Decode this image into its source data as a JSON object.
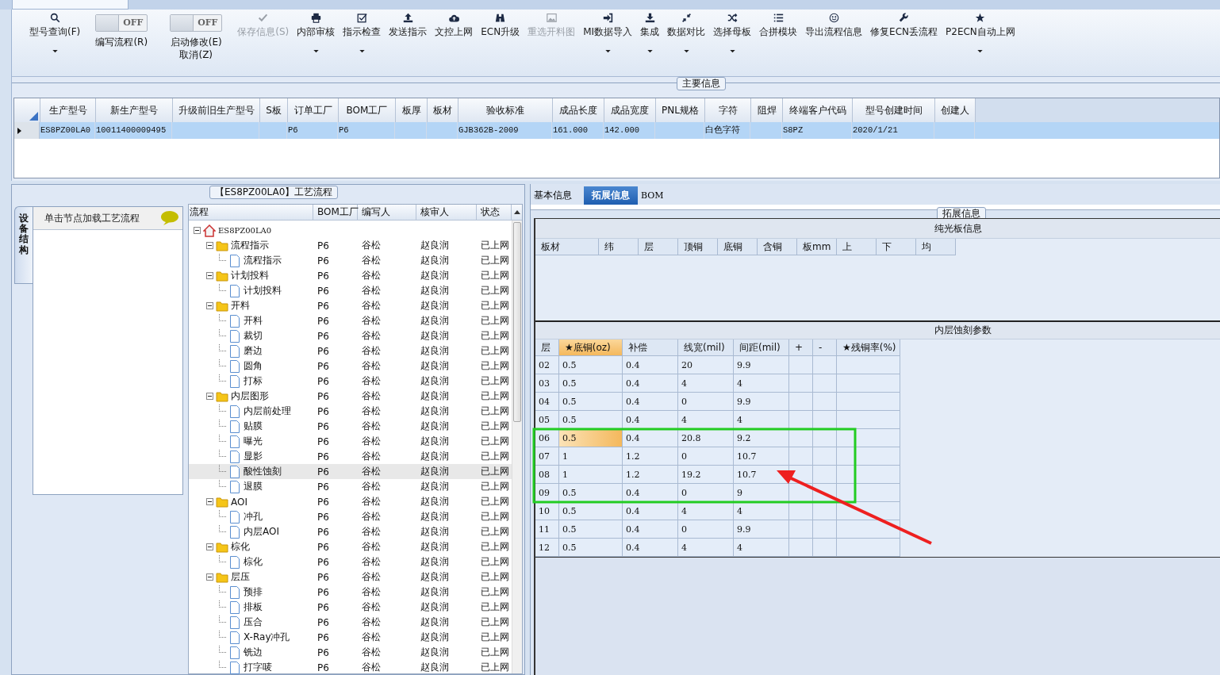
{
  "toolbar": {
    "items": [
      {
        "kind": "button",
        "label": "型号查询(F)",
        "dropdown": true,
        "disabled": false
      },
      {
        "kind": "toggle",
        "label": "编写流程(R)",
        "on": false,
        "state_text": "OFF"
      },
      {
        "kind": "toggle",
        "label": "启动修改(E) 取消(Z)",
        "on": false,
        "state_text": "OFF"
      },
      {
        "kind": "button",
        "label": "保存信息(S)",
        "dropdown": false,
        "disabled": true
      },
      {
        "kind": "button",
        "label": "内部审核",
        "dropdown": true,
        "disabled": false
      },
      {
        "kind": "button",
        "label": "指示检查",
        "dropdown": true,
        "disabled": false
      },
      {
        "kind": "button",
        "label": "发送指示",
        "dropdown": false,
        "disabled": false
      },
      {
        "kind": "button",
        "label": "文控上网",
        "dropdown": false,
        "disabled": false
      },
      {
        "kind": "button",
        "label": "ECN升级",
        "dropdown": false,
        "disabled": false
      },
      {
        "kind": "button",
        "label": "重选开料图",
        "dropdown": false,
        "disabled": true
      },
      {
        "kind": "button",
        "label": "MI数据导入",
        "dropdown": true,
        "disabled": false
      },
      {
        "kind": "button",
        "label": "集成",
        "dropdown": true,
        "disabled": false
      },
      {
        "kind": "button",
        "label": "数据对比",
        "dropdown": true,
        "disabled": false
      },
      {
        "kind": "button",
        "label": "选择母板",
        "dropdown": true,
        "disabled": false
      },
      {
        "kind": "button",
        "label": "合拼模块",
        "dropdown": false,
        "disabled": false
      },
      {
        "kind": "button",
        "label": "导出流程信息",
        "dropdown": false,
        "disabled": false
      },
      {
        "kind": "button",
        "label": "修复ECN丢流程",
        "dropdown": false,
        "disabled": false
      },
      {
        "kind": "button",
        "label": "P2ECN自动上网",
        "dropdown": true,
        "disabled": false
      }
    ]
  },
  "main_info": {
    "title": "主要信息",
    "columns": [
      "生产型号",
      "新生产型号",
      "升级前旧生产型号",
      "S板",
      "订单工厂",
      "BOM工厂",
      "板厚",
      "板材",
      "验收标准",
      "成品长度",
      "成品宽度",
      "PNL规格",
      "字符",
      "阻焊",
      "终端客户代码",
      "型号创建时间",
      "创建人"
    ],
    "rows": [
      {
        "selected": true,
        "cells": [
          "ES8PZ00LA0",
          "10011400009495",
          null,
          null,
          "P6",
          "P6",
          null,
          null,
          "GJB362B-2009",
          "161.000",
          "142.000",
          null,
          "白色字符",
          null,
          "S8PZ",
          "2020/1/21",
          null
        ]
      }
    ]
  },
  "process": {
    "title": "【ES8PZ00LA0】工艺流程",
    "side_tab": "设备结构",
    "hint": "单击节点加载工艺流程",
    "columns": [
      "流程",
      "BOM工厂",
      "编写人",
      "核审人",
      "状态"
    ],
    "tree": {
      "label": "ES8PZ00LA0",
      "expanded": true,
      "selected": false,
      "children": [
        {
          "label": "流程指示",
          "bom": "P6",
          "writer": "谷松",
          "reviewer": "赵良润",
          "status": "已上网",
          "expanded": true,
          "selected": false,
          "children": [
            {
              "label": "流程指示",
              "bom": "P6",
              "writer": "谷松",
              "reviewer": "赵良润",
              "status": "已上网",
              "selected": false
            }
          ]
        },
        {
          "label": "计划投料",
          "bom": "P6",
          "writer": "谷松",
          "reviewer": "赵良润",
          "status": "已上网",
          "expanded": true,
          "selected": false,
          "children": [
            {
              "label": "计划投料",
              "bom": "P6",
              "writer": "谷松",
              "reviewer": "赵良润",
              "status": "已上网",
              "selected": false
            }
          ]
        },
        {
          "label": "开料",
          "bom": "P6",
          "writer": "谷松",
          "reviewer": "赵良润",
          "status": "已上网",
          "expanded": true,
          "selected": false,
          "children": [
            {
              "label": "开料",
              "bom": "P6",
              "writer": "谷松",
              "reviewer": "赵良润",
              "status": "已上网",
              "selected": false
            },
            {
              "label": "裁切",
              "bom": "P6",
              "writer": "谷松",
              "reviewer": "赵良润",
              "status": "已上网",
              "selected": false
            },
            {
              "label": "磨边",
              "bom": "P6",
              "writer": "谷松",
              "reviewer": "赵良润",
              "status": "已上网",
              "selected": false
            },
            {
              "label": "圆角",
              "bom": "P6",
              "writer": "谷松",
              "reviewer": "赵良润",
              "status": "已上网",
              "selected": false
            },
            {
              "label": "打标",
              "bom": "P6",
              "writer": "谷松",
              "reviewer": "赵良润",
              "status": "已上网",
              "selected": false
            }
          ]
        },
        {
          "label": "内层图形",
          "bom": "P6",
          "writer": "谷松",
          "reviewer": "赵良润",
          "status": "已上网",
          "expanded": true,
          "selected": false,
          "children": [
            {
              "label": "内层前处理",
              "bom": "P6",
              "writer": "谷松",
              "reviewer": "赵良润",
              "status": "已上网",
              "selected": false
            },
            {
              "label": "贴膜",
              "bom": "P6",
              "writer": "谷松",
              "reviewer": "赵良润",
              "status": "已上网",
              "selected": false
            },
            {
              "label": "曝光",
              "bom": "P6",
              "writer": "谷松",
              "reviewer": "赵良润",
              "status": "已上网",
              "selected": false
            },
            {
              "label": "显影",
              "bom": "P6",
              "writer": "谷松",
              "reviewer": "赵良润",
              "status": "已上网",
              "selected": false
            },
            {
              "label": "酸性蚀刻",
              "bom": "P6",
              "writer": "谷松",
              "reviewer": "赵良润",
              "status": "已上网",
              "selected": true
            },
            {
              "label": "退膜",
              "bom": "P6",
              "writer": "谷松",
              "reviewer": "赵良润",
              "status": "已上网",
              "selected": false
            }
          ]
        },
        {
          "label": "AOI",
          "bom": "P6",
          "writer": "谷松",
          "reviewer": "赵良润",
          "status": "已上网",
          "expanded": true,
          "selected": false,
          "children": [
            {
              "label": "冲孔",
              "bom": "P6",
              "writer": "谷松",
              "reviewer": "赵良润",
              "status": "已上网",
              "selected": false
            },
            {
              "label": "内层AOI",
              "bom": "P6",
              "writer": "谷松",
              "reviewer": "赵良润",
              "status": "已上网",
              "selected": false
            }
          ]
        },
        {
          "label": "棕化",
          "bom": "P6",
          "writer": "谷松",
          "reviewer": "赵良润",
          "status": "已上网",
          "expanded": true,
          "selected": false,
          "children": [
            {
              "label": "棕化",
              "bom": "P6",
              "writer": "谷松",
              "reviewer": "赵良润",
              "status": "已上网",
              "selected": false
            }
          ]
        },
        {
          "label": "层压",
          "bom": "P6",
          "writer": "谷松",
          "reviewer": "赵良润",
          "status": "已上网",
          "expanded": true,
          "selected": false,
          "children": [
            {
              "label": "预排",
              "bom": "P6",
              "writer": "谷松",
              "reviewer": "赵良润",
              "status": "已上网",
              "selected": false
            },
            {
              "label": "排板",
              "bom": "P6",
              "writer": "谷松",
              "reviewer": "赵良润",
              "status": "已上网",
              "selected": false
            },
            {
              "label": "压合",
              "bom": "P6",
              "writer": "谷松",
              "reviewer": "赵良润",
              "status": "已上网",
              "selected": false
            },
            {
              "label": "X-Ray冲孔",
              "bom": "P6",
              "writer": "谷松",
              "reviewer": "赵良润",
              "status": "已上网",
              "selected": false
            },
            {
              "label": "铣边",
              "bom": "P6",
              "writer": "谷松",
              "reviewer": "赵良润",
              "status": "已上网",
              "selected": false
            },
            {
              "label": "打字唛",
              "bom": "P6",
              "writer": "谷松",
              "reviewer": "赵良润",
              "status": "已上网",
              "selected": false
            }
          ]
        }
      ]
    }
  },
  "details": {
    "tabs": [
      {
        "label": "基本信息",
        "selected": false
      },
      {
        "label": "拓展信息",
        "selected": true
      },
      {
        "label": "BOM",
        "selected": false
      }
    ],
    "group_title": "拓展信息",
    "bare_board": {
      "title": "纯光板信息",
      "columns": [
        "板材",
        "纬",
        "层",
        "顶铜",
        "底铜",
        "含铜",
        "板mm",
        "上",
        "下",
        "均"
      ]
    },
    "etching": {
      "title": "内层蚀刻参数",
      "columns": [
        {
          "label": "层",
          "selected": false
        },
        {
          "label": "★底铜(oz)",
          "selected": true
        },
        {
          "label": "补偿",
          "selected": false
        },
        {
          "label": "线宽(mil)",
          "selected": false
        },
        {
          "label": "间距(mil)",
          "selected": false
        },
        {
          "label": "+",
          "selected": false
        },
        {
          "label": "-",
          "selected": false
        },
        {
          "label": "★残铜率(%)",
          "selected": false
        }
      ],
      "rows": [
        {
          "selected": false,
          "cells": [
            "02",
            "0.5",
            "0.4",
            "20",
            "9.9"
          ]
        },
        {
          "selected": false,
          "cells": [
            "03",
            "0.5",
            "0.4",
            "4",
            "4"
          ]
        },
        {
          "selected": false,
          "cells": [
            "04",
            "0.5",
            "0.4",
            "0",
            "9.9"
          ]
        },
        {
          "selected": false,
          "cells": [
            "05",
            "0.5",
            "0.4",
            "4",
            "4"
          ]
        },
        {
          "selected": true,
          "cells": [
            "06",
            "0.5",
            "0.4",
            "20.8",
            "9.2"
          ]
        },
        {
          "selected": false,
          "cells": [
            "07",
            "1",
            "1.2",
            "0",
            "10.7"
          ]
        },
        {
          "selected": false,
          "cells": [
            "08",
            "1",
            "1.2",
            "19.2",
            "10.7"
          ]
        },
        {
          "selected": false,
          "cells": [
            "09",
            "0.5",
            "0.4",
            "0",
            "9"
          ]
        },
        {
          "selected": false,
          "cells": [
            "10",
            "0.5",
            "0.4",
            "4",
            "4"
          ]
        },
        {
          "selected": false,
          "cells": [
            "11",
            "0.5",
            "0.4",
            "0",
            "9.9"
          ]
        },
        {
          "selected": false,
          "cells": [
            "12",
            "0.5",
            "0.4",
            "4",
            "4"
          ]
        }
      ]
    },
    "annotations": [
      {
        "kind": "highlight-box",
        "color": "#22cc22"
      },
      {
        "kind": "arrow",
        "color": "#ee2020"
      }
    ]
  }
}
